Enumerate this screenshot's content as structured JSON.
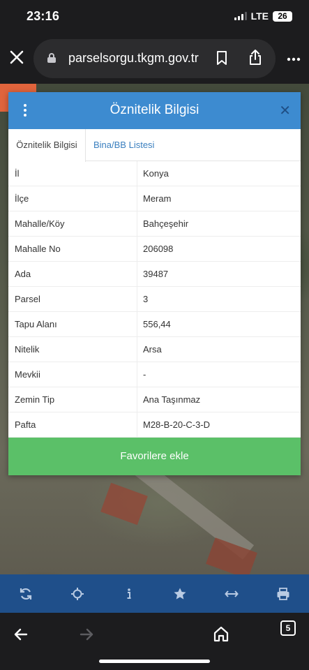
{
  "status_bar": {
    "time": "23:16",
    "network": "LTE",
    "battery": "26"
  },
  "browser": {
    "url": "parselsorgu.tkgm.gov.tr",
    "open_tabs": "5"
  },
  "panel": {
    "title": "Öznitelik Bilgisi",
    "close_label": "✕",
    "tabs": [
      {
        "label": "Öznitelik Bilgisi",
        "active": true
      },
      {
        "label": "Bina/BB Listesi",
        "active": false
      }
    ],
    "rows": [
      {
        "key": "İl",
        "value": "Konya"
      },
      {
        "key": "İlçe",
        "value": "Meram"
      },
      {
        "key": "Mahalle/Köy",
        "value": "Bahçeşehir"
      },
      {
        "key": "Mahalle No",
        "value": "206098"
      },
      {
        "key": "Ada",
        "value": "39487"
      },
      {
        "key": "Parsel",
        "value": "3"
      },
      {
        "key": "Tapu Alanı",
        "value": "556,44"
      },
      {
        "key": "Nitelik",
        "value": "Arsa"
      },
      {
        "key": "Mevkii",
        "value": "-"
      },
      {
        "key": "Zemin Tip",
        "value": "Ana Taşınmaz"
      },
      {
        "key": "Pafta",
        "value": "M28-B-20-C-3-D"
      }
    ],
    "favorite_button": "Favorilere ekle"
  },
  "map_toolbar": {
    "icons": [
      "refresh-icon",
      "locate-icon",
      "info-icon",
      "star-icon",
      "measure-icon",
      "print-icon"
    ]
  },
  "colors": {
    "header_blue": "#3d8bd0",
    "favorite_green": "#5bc068",
    "toolbar_blue": "#1f4f8a",
    "tab_link": "#3a7fbf"
  }
}
